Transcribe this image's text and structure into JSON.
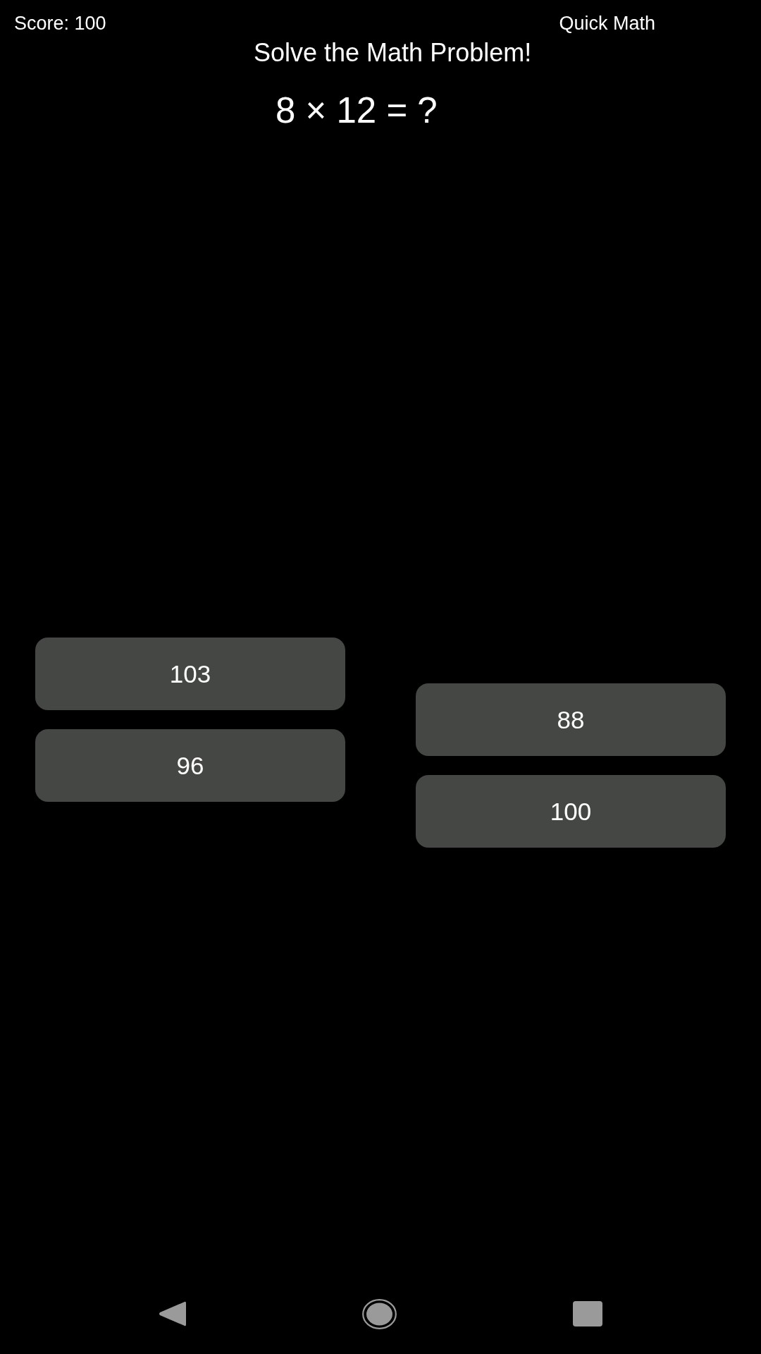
{
  "header": {
    "score": "Score: 100",
    "app_title": "Quick Math"
  },
  "prompt": "Solve the Math Problem!",
  "problem": "8 × 12 = ?",
  "answer_columns": [
    {
      "answers": [
        {
          "label": "103"
        },
        {
          "label": "96"
        }
      ]
    },
    {
      "answers": [
        {
          "label": "88"
        },
        {
          "label": "100"
        }
      ]
    }
  ]
}
